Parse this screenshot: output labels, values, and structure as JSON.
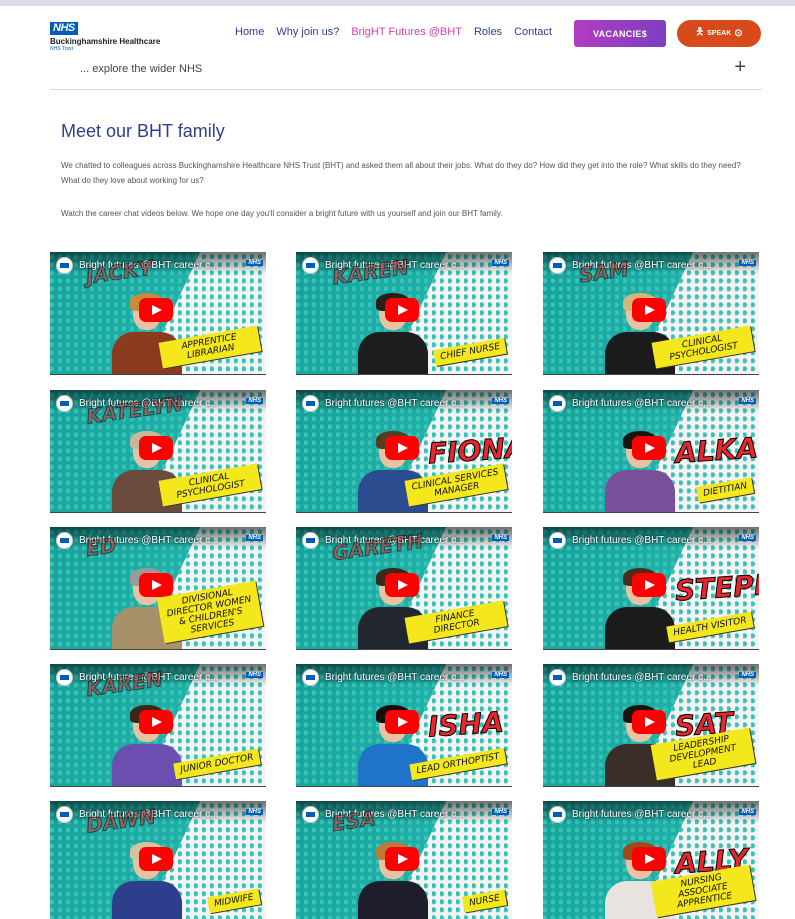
{
  "header": {
    "logo": {
      "badge": "NHS",
      "name": "Buckinghamshire Healthcare",
      "sub": "NHS Trust"
    },
    "nav": [
      {
        "label": "Home"
      },
      {
        "label": "Why join us?"
      },
      {
        "label": "BrigHT Futures @BHT",
        "active": true
      },
      {
        "label": "Roles"
      },
      {
        "label": "Contact"
      }
    ],
    "vacancies_label": "VACANCIE$",
    "speak_label": "SPEAK"
  },
  "accordion": {
    "label": "... explore the wider NHS",
    "icon": "plus-icon"
  },
  "section": {
    "title": "Meet our BHT family",
    "para1": "We chatted to colleagues across Buckinghamshire Healthcare NHS Trust (BHT) and asked them all about their jobs. What do they do? How did they get into the role? What skills do they need? What do they love about working for us?",
    "para2": "Watch the career chat videos below. We hope one day you'll consider a bright future with us yourself and join our BHT family."
  },
  "videos": [
    {
      "title": "Bright futures @BHT career c...",
      "name": "JACKY",
      "name_style": "faded",
      "role": "APPRENTICE LIBRARIAN",
      "hair": "#c98a3a",
      "top": "#8a3b1e"
    },
    {
      "title": "Bright futures @BHT career c...",
      "name": "KAREN",
      "name_style": "faded",
      "role": "CHIEF NURSE",
      "hair": "#2a2018",
      "top": "#1d1d1d"
    },
    {
      "title": "Bright futures @BHT career c...",
      "name": "SAM",
      "name_style": "faded",
      "role": "CLINICAL PSYCHOLOGIST",
      "hair": "#d8b477",
      "top": "#1c1c1c"
    },
    {
      "title": "Bright futures @BHT career c...",
      "name": "KATELYN",
      "name_style": "faded",
      "role": "CLINICAL PSYCHOLOGIST",
      "hair": "#c9b79a",
      "top": "#6b4b3b"
    },
    {
      "title": "Bright futures @BHT career c...",
      "name": "FIONA",
      "name_style": "big",
      "role": "CLINICAL SERVICES MANAGER",
      "hair": "#5a3a22",
      "top": "#2b4c8f"
    },
    {
      "title": "Bright futures @BHT career c...",
      "name": "ALKA",
      "name_style": "big",
      "role": "DIETITIAN",
      "hair": "#1a1410",
      "top": "#7a4f9a"
    },
    {
      "title": "Bright futures @BHT career c...",
      "name": "ED",
      "name_style": "faded",
      "role": "DIVISIONAL DIRECTOR WOMEN & CHILDREN'S SERVICES",
      "hair": "#9a9a9a",
      "top": "#a8916a"
    },
    {
      "title": "Bright futures @BHT career c...",
      "name": "GARETH",
      "name_style": "faded",
      "role": "FINANCE DIRECTOR",
      "hair": "#3a2a1c",
      "top": "#22262e"
    },
    {
      "title": "Bright futures @BHT career c...",
      "name": "STEPH",
      "name_style": "big",
      "role": "HEALTH VISITOR",
      "hair": "#4a2e1c",
      "top": "#1b1b1b"
    },
    {
      "title": "Bright futures @BHT career c...",
      "name": "KAREN",
      "name_style": "faded",
      "role": "JUNIOR DOCTOR",
      "hair": "#3b2618",
      "top": "#6a4fb0"
    },
    {
      "title": "Bright futures @BHT career c...",
      "name": "ISHA",
      "name_style": "big",
      "role": "LEAD ORTHOPTIST",
      "hair": "#140f0c",
      "top": "#1f74c9"
    },
    {
      "title": "Bright futures @BHT career c...",
      "name": "SAT",
      "name_style": "big",
      "role": "LEADERSHIP DEVELOPMENT LEAD",
      "hair": "#1a1410",
      "top": "#3a2f28"
    },
    {
      "title": "Bright futures @BHT career c...",
      "name": "DAWN",
      "name_style": "faded",
      "role": "MIDWIFE",
      "hair": "#d4c2a0",
      "top": "#2d3e8c"
    },
    {
      "title": "Bright futures @BHT career c...",
      "name": "ESA",
      "name_style": "faded",
      "role": "NURSE",
      "hair": "#c07a36",
      "top": "#1d1d2b"
    },
    {
      "title": "Bright futures @BHT career c...",
      "name": "ALLY",
      "name_style": "big",
      "role": "NURSING ASSOCIATE APPRENTICE",
      "hair": "#a04a1c",
      "top": "#e8e3df"
    }
  ]
}
